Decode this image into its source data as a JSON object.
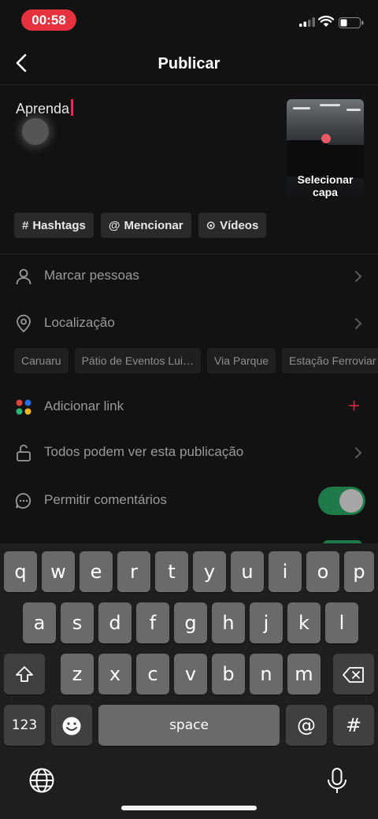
{
  "status": {
    "time": "00:58"
  },
  "header": {
    "title": "Publicar"
  },
  "compose": {
    "caption": "Aprenda",
    "cover_label": "Selecionar capa"
  },
  "chips": [
    {
      "icon": "#",
      "label": "Hashtags"
    },
    {
      "icon": "@",
      "label": "Mencionar"
    },
    {
      "icon": "⊙",
      "label": "Vídeos"
    }
  ],
  "options": {
    "tag_people": "Marcar pessoas",
    "location": "Localização",
    "add_link": "Adicionar link",
    "privacy": "Todos podem ver esta publicação",
    "comments": "Permitir comentários"
  },
  "location_suggestions": [
    "Caruaru",
    "Pátio de Eventos Lui…",
    "Via Parque",
    "Estação Ferroviar"
  ],
  "toggles": {
    "allow_comments": true
  },
  "keyboard": {
    "row1": [
      "q",
      "w",
      "e",
      "r",
      "t",
      "y",
      "u",
      "i",
      "o",
      "p"
    ],
    "row2": [
      "a",
      "s",
      "d",
      "f",
      "g",
      "h",
      "j",
      "k",
      "l"
    ],
    "row3": [
      "z",
      "x",
      "c",
      "v",
      "b",
      "n",
      "m"
    ],
    "numbers": "123",
    "space": "space",
    "at": "@",
    "hash": "#"
  },
  "colors": {
    "accent": "#f0245a",
    "toggle_on": "#1f7a49",
    "time_pill": "#e5323e"
  }
}
